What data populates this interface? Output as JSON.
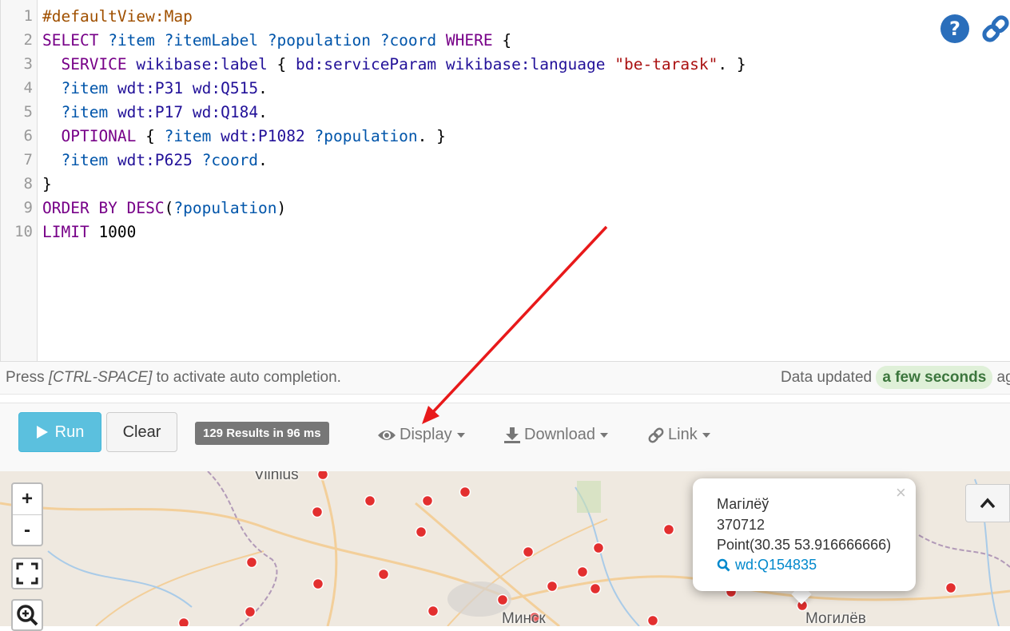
{
  "editor": {
    "line_numbers": [
      "1",
      "2",
      "3",
      "4",
      "5",
      "6",
      "7",
      "8",
      "9",
      "10"
    ],
    "lines": [
      [
        {
          "t": "#defaultView:Map",
          "c": "meta"
        }
      ],
      [
        {
          "t": "SELECT",
          "c": "kw"
        },
        {
          "t": " ",
          "c": "plain"
        },
        {
          "t": "?item",
          "c": "var"
        },
        {
          "t": " ",
          "c": "plain"
        },
        {
          "t": "?itemLabel",
          "c": "var"
        },
        {
          "t": " ",
          "c": "plain"
        },
        {
          "t": "?population",
          "c": "var"
        },
        {
          "t": " ",
          "c": "plain"
        },
        {
          "t": "?coord",
          "c": "var"
        },
        {
          "t": " ",
          "c": "plain"
        },
        {
          "t": "WHERE",
          "c": "kw"
        },
        {
          "t": " {",
          "c": "plain"
        }
      ],
      [
        {
          "t": "  ",
          "c": "plain"
        },
        {
          "t": "SERVICE",
          "c": "kw"
        },
        {
          "t": " ",
          "c": "plain"
        },
        {
          "t": "wikibase:label",
          "c": "pfx"
        },
        {
          "t": " { ",
          "c": "plain"
        },
        {
          "t": "bd:serviceParam",
          "c": "pfx"
        },
        {
          "t": " ",
          "c": "plain"
        },
        {
          "t": "wikibase:language",
          "c": "pfx"
        },
        {
          "t": " ",
          "c": "plain"
        },
        {
          "t": "\"be-tarask\"",
          "c": "str"
        },
        {
          "t": ". }",
          "c": "plain"
        }
      ],
      [
        {
          "t": "  ",
          "c": "plain"
        },
        {
          "t": "?item",
          "c": "var"
        },
        {
          "t": " ",
          "c": "plain"
        },
        {
          "t": "wdt:P31",
          "c": "pfx"
        },
        {
          "t": " ",
          "c": "plain"
        },
        {
          "t": "wd:Q515",
          "c": "pfx"
        },
        {
          "t": ".",
          "c": "plain"
        }
      ],
      [
        {
          "t": "  ",
          "c": "plain"
        },
        {
          "t": "?item",
          "c": "var"
        },
        {
          "t": " ",
          "c": "plain"
        },
        {
          "t": "wdt:P17",
          "c": "pfx"
        },
        {
          "t": " ",
          "c": "plain"
        },
        {
          "t": "wd:Q184",
          "c": "pfx"
        },
        {
          "t": ".",
          "c": "plain"
        }
      ],
      [
        {
          "t": "  ",
          "c": "plain"
        },
        {
          "t": "OPTIONAL",
          "c": "kw"
        },
        {
          "t": " { ",
          "c": "plain"
        },
        {
          "t": "?item",
          "c": "var"
        },
        {
          "t": " ",
          "c": "plain"
        },
        {
          "t": "wdt:P1082",
          "c": "pfx"
        },
        {
          "t": " ",
          "c": "plain"
        },
        {
          "t": "?population",
          "c": "var"
        },
        {
          "t": ". }",
          "c": "plain"
        }
      ],
      [
        {
          "t": "  ",
          "c": "plain"
        },
        {
          "t": "?item",
          "c": "var"
        },
        {
          "t": " ",
          "c": "plain"
        },
        {
          "t": "wdt:P625",
          "c": "pfx"
        },
        {
          "t": " ",
          "c": "plain"
        },
        {
          "t": "?coord",
          "c": "var"
        },
        {
          "t": ".",
          "c": "plain"
        }
      ],
      [
        {
          "t": "}",
          "c": "plain"
        }
      ],
      [
        {
          "t": "ORDER BY DESC",
          "c": "kw"
        },
        {
          "t": "(",
          "c": "plain"
        },
        {
          "t": "?population",
          "c": "var"
        },
        {
          "t": ")",
          "c": "plain"
        }
      ],
      [
        {
          "t": "LIMIT",
          "c": "kw"
        },
        {
          "t": " 1000",
          "c": "plain"
        }
      ]
    ]
  },
  "status": {
    "hint_prefix": "Press ",
    "hint_key": "[CTRL-SPACE]",
    "hint_suffix": " to activate auto completion.",
    "data_updated_label": "Data updated ",
    "data_updated_badge": "a few seconds",
    "data_updated_suffix": " ag"
  },
  "toolbar": {
    "run_label": "Run",
    "clear_label": "Clear",
    "results_badge": "129 Results in 96 ms",
    "display_label": "Display",
    "download_label": "Download",
    "link_label": "Link"
  },
  "map": {
    "zoom_in": "+",
    "zoom_out": "-",
    "label_vilnius": "Vilnius",
    "label_minsk": "Минск",
    "label_mogilev": "Могилёв",
    "popup": {
      "close": "×",
      "name": "Магілёў",
      "population": "370712",
      "coord": "Point(30.35 53.916666666)",
      "link": "wd:Q154835"
    }
  },
  "colors": {
    "marker": "#e32f2f",
    "accent_run": "#5bc0de",
    "badge_gray": "#777777",
    "annotation_arrow": "#e8191a"
  }
}
